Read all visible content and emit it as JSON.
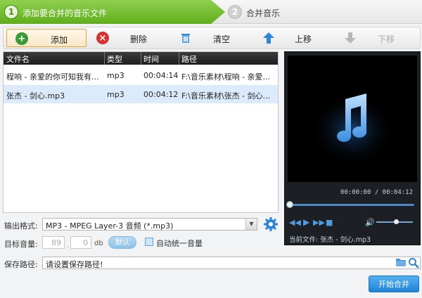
{
  "steps": [
    {
      "num": "1",
      "label": "添加要合并的音乐文件"
    },
    {
      "num": "2",
      "label": "合并音乐"
    }
  ],
  "toolbar": {
    "add": "添加",
    "delete": "删除",
    "clear": "清空",
    "move_up": "上移",
    "move_down": "下移"
  },
  "table": {
    "headers": [
      "文件名",
      "类型",
      "时间",
      "路径"
    ],
    "rows": [
      {
        "name": "程响 - 亲爱的你可知我有...",
        "type": "mp3",
        "time": "00:04:14",
        "path": "F:\\音乐素材\\程响 - 亲爱..."
      },
      {
        "name": "张杰 - 剑心.mp3",
        "type": "mp3",
        "time": "00:04:12",
        "path": "F:\\音乐素材\\张杰 - 剑心..."
      }
    ],
    "selected_row": 1
  },
  "player": {
    "time_display": "00:00:00 / 00:04:12",
    "now_playing": "当前文件: 张杰 - 剑心.mp3",
    "progress": 0,
    "volume": 0.5
  },
  "output": {
    "format_label": "输出格式:",
    "format_value": "MP3 - MPEG Layer-3 音频 (*.mp3)",
    "volume_label": "目标音量:",
    "volume_int": "89",
    "volume_dec": "0",
    "volume_unit": "db",
    "default_btn": "默认",
    "auto_volume_label": "自动统一音量",
    "path_label": "保存路径:",
    "path_placeholder": "请设置保存路径!",
    "start_btn": "开始合并"
  },
  "colors": {
    "step_active": "#6cbb2a",
    "accent_blue": "#1f82d6",
    "selected_row": "#dcebfb"
  }
}
